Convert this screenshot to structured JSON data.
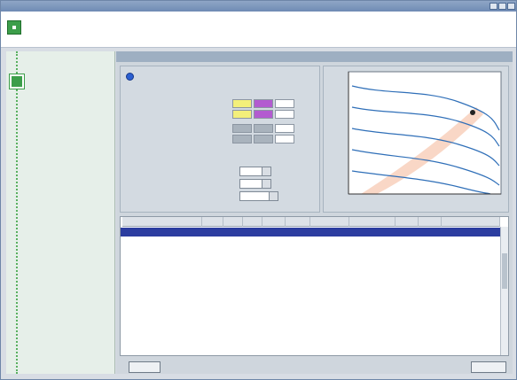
{
  "window": {
    "app_title": ""
  },
  "header": {
    "title": "",
    "subtitle": ""
  },
  "sidebar": {
    "active_step": "",
    "active_substeps": [
      "",
      ""
    ],
    "inactive_steps": [
      "",
      "",
      "",
      ""
    ]
  },
  "main": {
    "title": ""
  },
  "params": {
    "model_label": "",
    "model_code": "",
    "group1_title": "",
    "column_headers": [
      "",
      "",
      ""
    ],
    "rows": [
      {
        "label": "",
        "symbol": "",
        "unit": "",
        "values": [
          "",
          "",
          ""
        ]
      },
      {
        "label": "",
        "symbol": "",
        "unit": "",
        "values": [
          "",
          "",
          ""
        ]
      },
      {
        "label": "",
        "symbol": "",
        "unit": "",
        "values": [
          "",
          "",
          ""
        ]
      },
      {
        "label": "",
        "symbol": "",
        "unit": "",
        "values": [
          "",
          "",
          ""
        ]
      }
    ],
    "group2_title": "",
    "fields": [
      {
        "label": "",
        "value": ""
      },
      {
        "label": "",
        "value": ""
      },
      {
        "label": "",
        "value": ""
      }
    ]
  },
  "chart_data": {
    "type": "line",
    "title": "",
    "xlabel": "",
    "ylabel": "",
    "x_ticks": [
      "",
      "",
      "",
      "",
      ""
    ],
    "y_ticks": [
      "",
      "",
      "",
      "",
      "",
      "",
      ""
    ],
    "grid": false,
    "series": []
  },
  "table": {
    "columns": [
      "",
      "",
      "",
      "",
      "",
      "",
      "",
      "",
      "",
      "",
      ""
    ],
    "selected_row_index": 0,
    "rows": [
      [
        "",
        "",
        "",
        "",
        "",
        "",
        "",
        "",
        "",
        "",
        ""
      ],
      [
        "",
        "",
        "",
        "",
        "",
        "",
        "",
        "",
        "",
        "",
        ""
      ],
      [
        "",
        "",
        "",
        "",
        "",
        "",
        "",
        "",
        "",
        "",
        ""
      ],
      [
        "",
        "",
        "",
        "",
        "",
        "",
        "",
        "",
        "",
        "",
        ""
      ],
      [
        "",
        "",
        "",
        "",
        "",
        "",
        "",
        "",
        "",
        "",
        ""
      ],
      [
        "",
        "",
        "",
        "",
        "",
        "",
        "",
        "",
        "",
        "",
        ""
      ],
      [
        "",
        "",
        "",
        "",
        "",
        "",
        "",
        "",
        "",
        "",
        ""
      ],
      [
        "",
        "",
        "",
        "",
        "",
        "",
        "",
        "",
        "",
        "",
        ""
      ],
      [
        "",
        "",
        "",
        "",
        "",
        "",
        "",
        "",
        "",
        "",
        ""
      ],
      [
        "",
        "",
        "",
        "",
        "",
        "",
        "",
        "",
        "",
        "",
        ""
      ],
      [
        "",
        "",
        "",
        "",
        "",
        "",
        "",
        "",
        "",
        "",
        ""
      ],
      [
        "",
        "",
        "",
        "",
        "",
        "",
        "",
        "",
        "",
        "",
        ""
      ],
      [
        "",
        "",
        "",
        "",
        "",
        "",
        "",
        "",
        "",
        "",
        ""
      ],
      [
        "",
        "",
        "",
        "",
        "",
        "",
        "",
        "",
        "",
        "",
        ""
      ]
    ]
  },
  "footer": {
    "back_label": "",
    "next_label": ""
  },
  "colors": {
    "accent_green": "#3c9e4a",
    "selection_blue": "#2c3da0",
    "cell_yellow": "#f3ef7a",
    "cell_purple": "#b35bd0"
  },
  "icons": {
    "header": "calculator-icon",
    "step": "calculator-icon",
    "radio": "radio-selected-icon"
  }
}
